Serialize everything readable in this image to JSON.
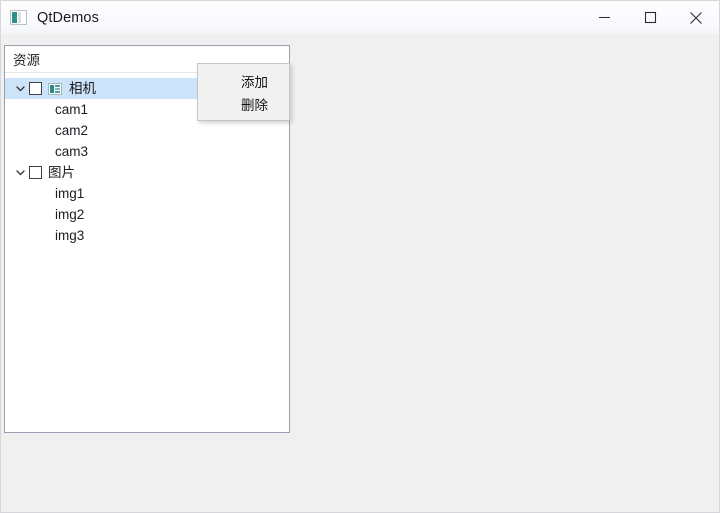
{
  "window": {
    "title": "QtDemos",
    "icon_name": "app-icon",
    "background_color": "#f0f0f0",
    "titlebar_color": "#fbfcfe"
  },
  "window_controls": {
    "minimize_label": "Minimize",
    "maximize_label": "Maximize",
    "close_label": "Close"
  },
  "tree": {
    "header_label": "资源",
    "selection_color": "#cde3fa",
    "groups": [
      {
        "label": "相机",
        "expanded": true,
        "checked": false,
        "selected": true,
        "has_icon": true,
        "icon_name": "camera-item-icon",
        "children": [
          {
            "label": "cam1"
          },
          {
            "label": "cam2"
          },
          {
            "label": "cam3"
          }
        ]
      },
      {
        "label": "图片",
        "expanded": true,
        "checked": false,
        "selected": false,
        "has_icon": false,
        "icon_name": "",
        "children": [
          {
            "label": "img1"
          },
          {
            "label": "img2"
          },
          {
            "label": "img3"
          }
        ]
      }
    ]
  },
  "context_menu": {
    "visible": true,
    "items": [
      {
        "label": "添加"
      },
      {
        "label": "删除"
      }
    ]
  }
}
